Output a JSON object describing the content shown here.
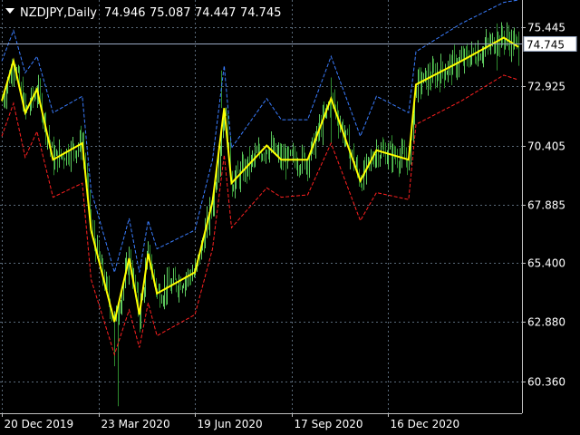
{
  "chart_data": {
    "type": "line",
    "title": "NZDJPY,Daily",
    "ohlc": {
      "open": "74.946",
      "high": "75.087",
      "low": "74.447",
      "close": "74.745"
    },
    "current_price": {
      "label": "74.745",
      "value": 74.745
    },
    "y_ticks": [
      75.445,
      72.925,
      70.405,
      67.885,
      65.4,
      62.88,
      60.36
    ],
    "y_tick_labels": [
      "75.445",
      "72.925",
      "70.405",
      "67.885",
      "65.400",
      "62.880",
      "60.360"
    ],
    "ylim": [
      59.0,
      76.6
    ],
    "x_tick_labels": [
      "20 Dec 2019",
      "23 Mar 2020",
      "19 Jun 2020",
      "17 Sep 2020",
      "16 Dec 2020"
    ],
    "x_tick_index": [
      0,
      66,
      132,
      198,
      264
    ],
    "n_bars": 276,
    "grid": true,
    "colors": {
      "background": "#000000",
      "grid": "#5a6a7a",
      "axis": "#c0c0c0",
      "text": "#ffffff",
      "price_line": "#9aa9c4",
      "bars": "#2e8b2e",
      "bars_bright": "#5fc95f",
      "mid_line": "#ffff00",
      "upper_band": "#3a7dff",
      "lower_band": "#ff2020"
    },
    "series": [
      {
        "key": "mid",
        "points": [
          [
            0,
            72.3
          ],
          [
            8,
            74.0
          ],
          [
            16,
            71.8
          ],
          [
            24,
            72.8
          ],
          [
            35,
            69.8
          ],
          [
            55,
            70.5
          ],
          [
            61,
            66.8
          ],
          [
            77,
            62.9
          ],
          [
            87,
            65.6
          ],
          [
            94,
            63.2
          ],
          [
            100,
            65.8
          ],
          [
            106,
            64.1
          ],
          [
            132,
            65.0
          ],
          [
            144,
            68.0
          ],
          [
            152,
            72.0
          ],
          [
            157,
            68.8
          ],
          [
            181,
            70.4
          ],
          [
            191,
            69.8
          ],
          [
            209,
            69.8
          ],
          [
            225,
            72.4
          ],
          [
            245,
            68.9
          ],
          [
            256,
            70.2
          ],
          [
            278,
            69.8
          ],
          [
            283,
            73.0
          ],
          [
            314,
            74.0
          ],
          [
            343,
            75.0
          ],
          [
            353,
            74.6
          ]
        ]
      },
      {
        "key": "upper",
        "points": [
          [
            0,
            74.0
          ],
          [
            8,
            75.3
          ],
          [
            16,
            73.5
          ],
          [
            24,
            74.2
          ],
          [
            35,
            71.8
          ],
          [
            55,
            72.5
          ],
          [
            61,
            68.5
          ],
          [
            77,
            65.0
          ],
          [
            87,
            67.3
          ],
          [
            94,
            65.0
          ],
          [
            100,
            67.2
          ],
          [
            106,
            66.0
          ],
          [
            132,
            66.8
          ],
          [
            144,
            69.8
          ],
          [
            152,
            73.8
          ],
          [
            157,
            70.3
          ],
          [
            181,
            72.4
          ],
          [
            191,
            71.5
          ],
          [
            209,
            71.5
          ],
          [
            225,
            74.2
          ],
          [
            245,
            70.8
          ],
          [
            256,
            72.5
          ],
          [
            278,
            71.8
          ],
          [
            283,
            74.4
          ],
          [
            314,
            75.6
          ],
          [
            343,
            76.5
          ],
          [
            353,
            76.6
          ]
        ]
      },
      {
        "key": "lower",
        "points": [
          [
            0,
            70.8
          ],
          [
            8,
            72.2
          ],
          [
            16,
            69.9
          ],
          [
            24,
            71.0
          ],
          [
            35,
            68.2
          ],
          [
            55,
            68.8
          ],
          [
            61,
            64.7
          ],
          [
            77,
            61.5
          ],
          [
            87,
            63.4
          ],
          [
            94,
            61.8
          ],
          [
            100,
            63.7
          ],
          [
            106,
            62.3
          ],
          [
            132,
            63.2
          ],
          [
            144,
            66.0
          ],
          [
            152,
            70.0
          ],
          [
            157,
            66.9
          ],
          [
            181,
            68.6
          ],
          [
            191,
            68.2
          ],
          [
            209,
            68.3
          ],
          [
            225,
            70.5
          ],
          [
            245,
            67.2
          ],
          [
            256,
            68.4
          ],
          [
            278,
            68.1
          ],
          [
            283,
            71.3
          ],
          [
            314,
            72.3
          ],
          [
            343,
            73.4
          ],
          [
            353,
            73.2
          ]
        ]
      }
    ]
  }
}
